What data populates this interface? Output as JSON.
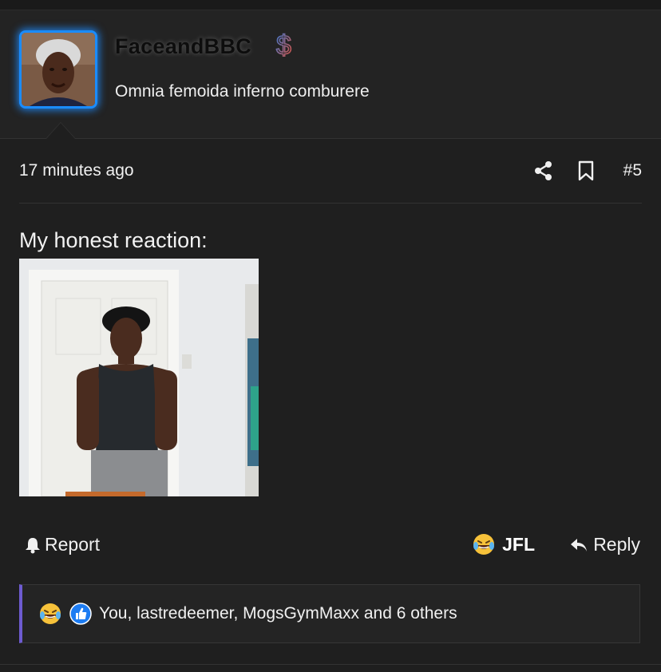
{
  "post": {
    "username": "FaceandBBC",
    "user_title": "Omnia femoida inferno comburere",
    "timestamp": "17 minutes ago",
    "post_number": "#5",
    "body_text": "My honest reaction:"
  },
  "actions": {
    "report_label": "Report",
    "jfl_label": "JFL",
    "reply_label": "Reply"
  },
  "reactions": {
    "summary": "You, lastredeemer, MogsGymMaxx and 6 others"
  },
  "colors": {
    "background": "#1f1f1f",
    "avatar_glow": "#1a8cff",
    "reaction_bar_accent": "#6d5bd0"
  },
  "icons": [
    "dollar-badge-icon",
    "share-icon",
    "bookmark-icon",
    "bell-icon",
    "crying-laughing-emoji-icon",
    "reply-arrow-icon",
    "thumbs-up-icon"
  ]
}
